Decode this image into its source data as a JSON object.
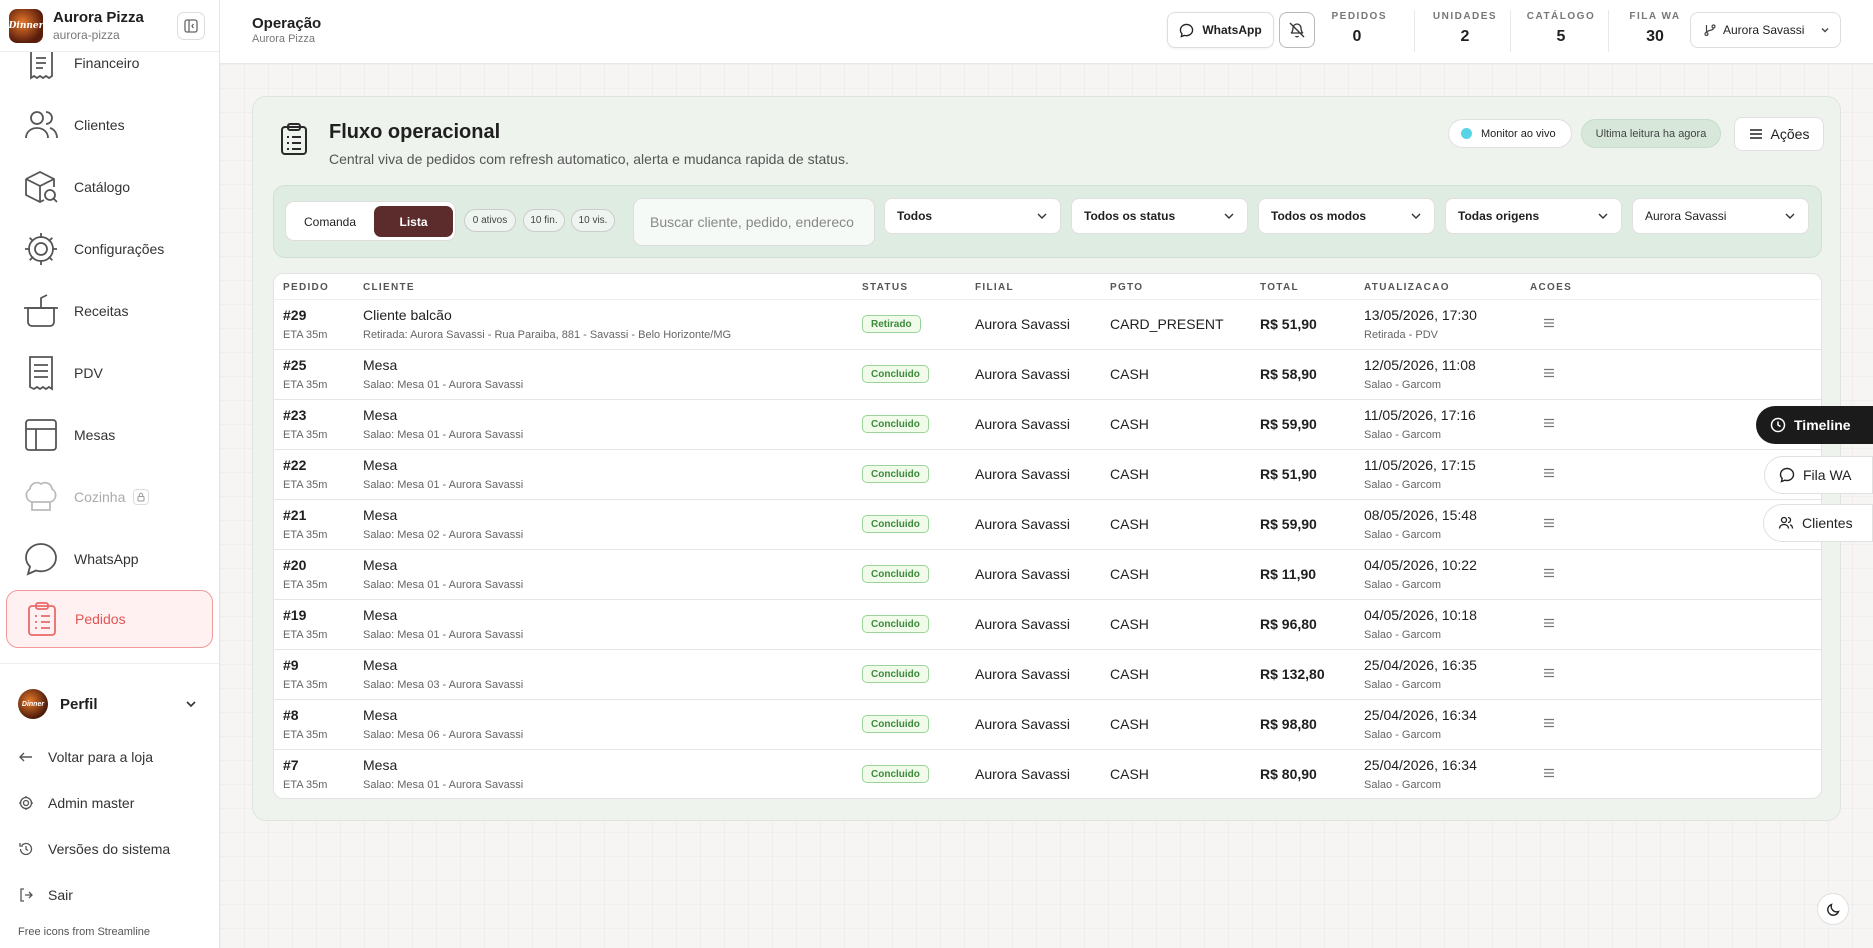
{
  "brand": {
    "name": "Aurora Pizza",
    "slug": "aurora-pizza",
    "logo_text": "Dinner"
  },
  "sidebar": {
    "items": [
      {
        "label": "Financeiro",
        "icon": "receipt-icon"
      },
      {
        "label": "Clientes",
        "icon": "users-icon"
      },
      {
        "label": "Catálogo",
        "icon": "box-search-icon"
      },
      {
        "label": "Configurações",
        "icon": "gear-icon"
      },
      {
        "label": "Receitas",
        "icon": "pot-icon"
      },
      {
        "label": "PDV",
        "icon": "receipt-list-icon"
      },
      {
        "label": "Mesas",
        "icon": "table-layout-icon"
      },
      {
        "label": "Cozinha",
        "icon": "chef-hat-icon",
        "locked": true
      },
      {
        "label": "WhatsApp",
        "icon": "chat-bubble-icon"
      },
      {
        "label": "Pedidos",
        "icon": "clipboard-icon",
        "active": true
      }
    ],
    "profile": {
      "label": "Perfil"
    },
    "links": [
      {
        "label": "Voltar para a loja",
        "icon": "arrow-left-icon"
      },
      {
        "label": "Admin master",
        "icon": "gear-icon"
      },
      {
        "label": "Versões do sistema",
        "icon": "history-icon"
      },
      {
        "label": "Sair",
        "icon": "logout-icon"
      }
    ],
    "credit": "Free icons from Streamline"
  },
  "topbar": {
    "title": "Operação",
    "subtitle": "Aurora Pizza",
    "whatsapp_label": "WhatsApp",
    "stats": [
      {
        "label": "PEDIDOS",
        "value": "0"
      },
      {
        "label": "UNIDADES",
        "value": "2"
      },
      {
        "label": "CATÁLOGO",
        "value": "5"
      },
      {
        "label": "FILA WA",
        "value": "30"
      }
    ],
    "branch": "Aurora Savassi"
  },
  "card": {
    "title": "Fluxo operacional",
    "subtitle": "Central viva de pedidos com refresh automatico, alerta e mudanca rapida de status.",
    "live_label": "Monitor ao vivo",
    "read_label": "Ultima leitura ha agora",
    "actions_label": "Ações"
  },
  "filters": {
    "view_comanda": "Comanda",
    "view_lista": "Lista",
    "counts": [
      "0 ativos",
      "10 fin.",
      "10 vis."
    ],
    "search_placeholder": "Buscar cliente, pedido, endereco",
    "selects": [
      "Todos",
      "Todos os status",
      "Todos os modos",
      "Todas origens",
      "Aurora Savassi"
    ]
  },
  "table": {
    "headers": [
      "PEDIDO",
      "CLIENTE",
      "STATUS",
      "FILIAL",
      "PGTO",
      "TOTAL",
      "ATUALIZACAO",
      "ACOES"
    ],
    "rows": [
      {
        "id": "#29",
        "eta": "ETA 35m",
        "client": "Cliente balcão",
        "address": "Retirada: Aurora Savassi - Rua Paraiba, 881 - Savassi - Belo Horizonte/MG",
        "status": "Retirado",
        "filial": "Aurora Savassi",
        "pgto": "CARD_PRESENT",
        "total": "R$ 51,90",
        "updated": "13/05/2026, 17:30",
        "origin": "Retirada - PDV"
      },
      {
        "id": "#25",
        "eta": "ETA 35m",
        "client": "Mesa",
        "address": "Salao: Mesa 01 - Aurora Savassi",
        "status": "Concluido",
        "filial": "Aurora Savassi",
        "pgto": "CASH",
        "total": "R$ 58,90",
        "updated": "12/05/2026, 11:08",
        "origin": "Salao - Garcom"
      },
      {
        "id": "#23",
        "eta": "ETA 35m",
        "client": "Mesa",
        "address": "Salao: Mesa 01 - Aurora Savassi",
        "status": "Concluido",
        "filial": "Aurora Savassi",
        "pgto": "CASH",
        "total": "R$ 59,90",
        "updated": "11/05/2026, 17:16",
        "origin": "Salao - Garcom"
      },
      {
        "id": "#22",
        "eta": "ETA 35m",
        "client": "Mesa",
        "address": "Salao: Mesa 01 - Aurora Savassi",
        "status": "Concluido",
        "filial": "Aurora Savassi",
        "pgto": "CASH",
        "total": "R$ 51,90",
        "updated": "11/05/2026, 17:15",
        "origin": "Salao - Garcom"
      },
      {
        "id": "#21",
        "eta": "ETA 35m",
        "client": "Mesa",
        "address": "Salao: Mesa 02 - Aurora Savassi",
        "status": "Concluido",
        "filial": "Aurora Savassi",
        "pgto": "CASH",
        "total": "R$ 59,90",
        "updated": "08/05/2026, 15:48",
        "origin": "Salao - Garcom"
      },
      {
        "id": "#20",
        "eta": "ETA 35m",
        "client": "Mesa",
        "address": "Salao: Mesa 01 - Aurora Savassi",
        "status": "Concluido",
        "filial": "Aurora Savassi",
        "pgto": "CASH",
        "total": "R$ 11,90",
        "updated": "04/05/2026, 10:22",
        "origin": "Salao - Garcom"
      },
      {
        "id": "#19",
        "eta": "ETA 35m",
        "client": "Mesa",
        "address": "Salao: Mesa 01 - Aurora Savassi",
        "status": "Concluido",
        "filial": "Aurora Savassi",
        "pgto": "CASH",
        "total": "R$ 96,80",
        "updated": "04/05/2026, 10:18",
        "origin": "Salao - Garcom"
      },
      {
        "id": "#9",
        "eta": "ETA 35m",
        "client": "Mesa",
        "address": "Salao: Mesa 03 - Aurora Savassi",
        "status": "Concluido",
        "filial": "Aurora Savassi",
        "pgto": "CASH",
        "total": "R$ 132,80",
        "updated": "25/04/2026, 16:35",
        "origin": "Salao - Garcom"
      },
      {
        "id": "#8",
        "eta": "ETA 35m",
        "client": "Mesa",
        "address": "Salao: Mesa 06 - Aurora Savassi",
        "status": "Concluido",
        "filial": "Aurora Savassi",
        "pgto": "CASH",
        "total": "R$ 98,80",
        "updated": "25/04/2026, 16:34",
        "origin": "Salao - Garcom"
      },
      {
        "id": "#7",
        "eta": "ETA 35m",
        "client": "Mesa",
        "address": "Salao: Mesa 01 - Aurora Savassi",
        "status": "Concluido",
        "filial": "Aurora Savassi",
        "pgto": "CASH",
        "total": "R$ 80,90",
        "updated": "25/04/2026, 16:34",
        "origin": "Salao - Garcom"
      }
    ]
  },
  "floating": {
    "timeline": "Timeline",
    "fila_wa": "Fila WA",
    "clientes": "Clientes"
  },
  "colors": {
    "accent": "#5c2b2b",
    "active_nav": "#e05555",
    "status_ok": "#3c8a3c",
    "live_dot": "#59d4e6"
  }
}
